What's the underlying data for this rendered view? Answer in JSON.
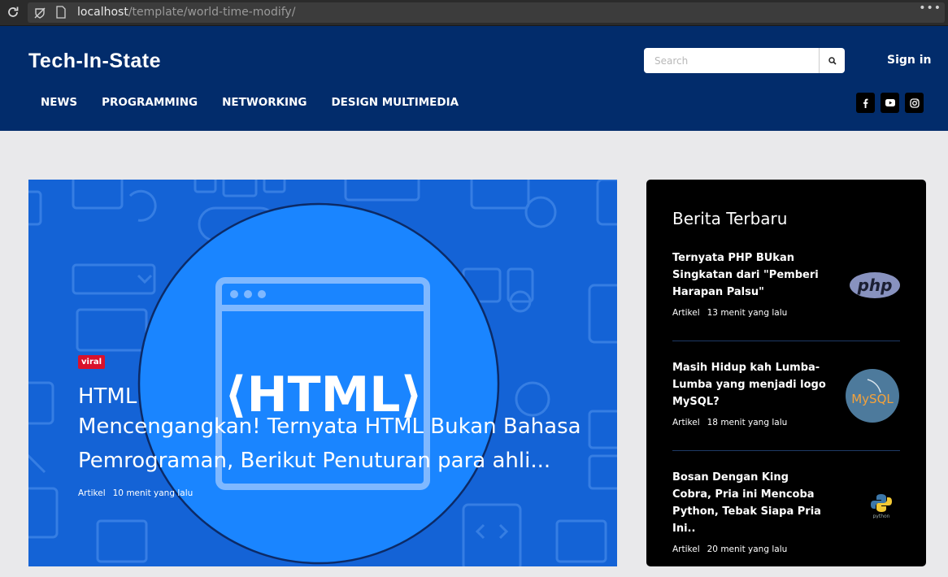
{
  "browser": {
    "url_host": "localhost",
    "url_path": "/template/world-time-modify/",
    "menu_label": "•••"
  },
  "header": {
    "brand": "Tech-In-State",
    "search_placeholder": "Search",
    "signin_label": "Sign in",
    "nav": [
      {
        "label": "NEWS"
      },
      {
        "label": "PROGRAMMING"
      },
      {
        "label": "NETWORKING"
      },
      {
        "label": "DESIGN MULTIMEDIA"
      }
    ],
    "social": [
      "facebook-icon",
      "youtube-icon",
      "instagram-icon"
    ]
  },
  "hero": {
    "badge": "viral",
    "category": "HTML",
    "title": "Mencengangkan! Ternyata HTML Bukan Bahasa Pemrograman, Berikut Penuturan para ahli...",
    "meta_type": "Artikel",
    "meta_time": "10 menit yang lalu",
    "image_text": "⟨HTML⟩",
    "colors": {
      "bg": "#1463d6",
      "circle": "#1a85ff"
    }
  },
  "sidebar": {
    "heading": "Berita Terbaru",
    "items": [
      {
        "title": "Ternyata PHP BUkan Singkatan dari \"Pemberi Harapan Palsu\"",
        "type": "Artikel",
        "time": "13 menit yang lalu",
        "thumb": "php",
        "thumb_text": "php"
      },
      {
        "title": "Masih Hidup kah Lumba-Lumba yang menjadi logo MySQL?",
        "type": "Artikel",
        "time": "18 menit yang lalu",
        "thumb": "mysql",
        "thumb_text": "MySQL"
      },
      {
        "title": "Bosan Dengan King Cobra, Pria ini Mencoba Python, Tebak Siapa Pria Ini..",
        "type": "Artikel",
        "time": "20 menit yang lalu",
        "thumb": "python",
        "thumb_text": "python"
      }
    ]
  }
}
